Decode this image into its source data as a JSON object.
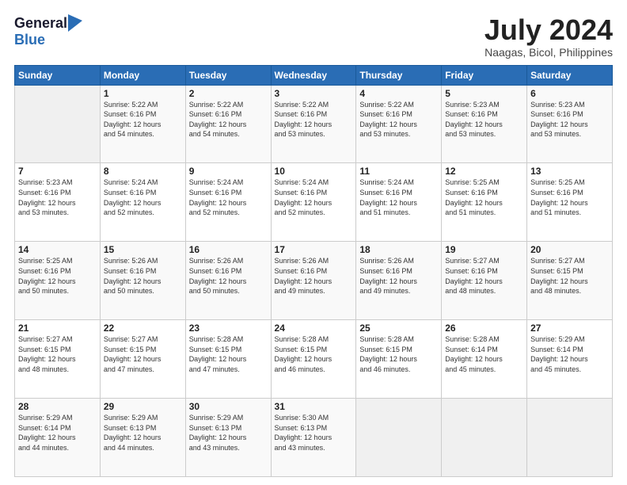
{
  "logo": {
    "general": "General",
    "blue": "Blue"
  },
  "title": "July 2024",
  "location": "Naagas, Bicol, Philippines",
  "header_days": [
    "Sunday",
    "Monday",
    "Tuesday",
    "Wednesday",
    "Thursday",
    "Friday",
    "Saturday"
  ],
  "weeks": [
    [
      {
        "day": "",
        "info": ""
      },
      {
        "day": "1",
        "info": "Sunrise: 5:22 AM\nSunset: 6:16 PM\nDaylight: 12 hours\nand 54 minutes."
      },
      {
        "day": "2",
        "info": "Sunrise: 5:22 AM\nSunset: 6:16 PM\nDaylight: 12 hours\nand 54 minutes."
      },
      {
        "day": "3",
        "info": "Sunrise: 5:22 AM\nSunset: 6:16 PM\nDaylight: 12 hours\nand 53 minutes."
      },
      {
        "day": "4",
        "info": "Sunrise: 5:22 AM\nSunset: 6:16 PM\nDaylight: 12 hours\nand 53 minutes."
      },
      {
        "day": "5",
        "info": "Sunrise: 5:23 AM\nSunset: 6:16 PM\nDaylight: 12 hours\nand 53 minutes."
      },
      {
        "day": "6",
        "info": "Sunrise: 5:23 AM\nSunset: 6:16 PM\nDaylight: 12 hours\nand 53 minutes."
      }
    ],
    [
      {
        "day": "7",
        "info": "Sunrise: 5:23 AM\nSunset: 6:16 PM\nDaylight: 12 hours\nand 53 minutes."
      },
      {
        "day": "8",
        "info": "Sunrise: 5:24 AM\nSunset: 6:16 PM\nDaylight: 12 hours\nand 52 minutes."
      },
      {
        "day": "9",
        "info": "Sunrise: 5:24 AM\nSunset: 6:16 PM\nDaylight: 12 hours\nand 52 minutes."
      },
      {
        "day": "10",
        "info": "Sunrise: 5:24 AM\nSunset: 6:16 PM\nDaylight: 12 hours\nand 52 minutes."
      },
      {
        "day": "11",
        "info": "Sunrise: 5:24 AM\nSunset: 6:16 PM\nDaylight: 12 hours\nand 51 minutes."
      },
      {
        "day": "12",
        "info": "Sunrise: 5:25 AM\nSunset: 6:16 PM\nDaylight: 12 hours\nand 51 minutes."
      },
      {
        "day": "13",
        "info": "Sunrise: 5:25 AM\nSunset: 6:16 PM\nDaylight: 12 hours\nand 51 minutes."
      }
    ],
    [
      {
        "day": "14",
        "info": "Sunrise: 5:25 AM\nSunset: 6:16 PM\nDaylight: 12 hours\nand 50 minutes."
      },
      {
        "day": "15",
        "info": "Sunrise: 5:26 AM\nSunset: 6:16 PM\nDaylight: 12 hours\nand 50 minutes."
      },
      {
        "day": "16",
        "info": "Sunrise: 5:26 AM\nSunset: 6:16 PM\nDaylight: 12 hours\nand 50 minutes."
      },
      {
        "day": "17",
        "info": "Sunrise: 5:26 AM\nSunset: 6:16 PM\nDaylight: 12 hours\nand 49 minutes."
      },
      {
        "day": "18",
        "info": "Sunrise: 5:26 AM\nSunset: 6:16 PM\nDaylight: 12 hours\nand 49 minutes."
      },
      {
        "day": "19",
        "info": "Sunrise: 5:27 AM\nSunset: 6:16 PM\nDaylight: 12 hours\nand 48 minutes."
      },
      {
        "day": "20",
        "info": "Sunrise: 5:27 AM\nSunset: 6:15 PM\nDaylight: 12 hours\nand 48 minutes."
      }
    ],
    [
      {
        "day": "21",
        "info": "Sunrise: 5:27 AM\nSunset: 6:15 PM\nDaylight: 12 hours\nand 48 minutes."
      },
      {
        "day": "22",
        "info": "Sunrise: 5:27 AM\nSunset: 6:15 PM\nDaylight: 12 hours\nand 47 minutes."
      },
      {
        "day": "23",
        "info": "Sunrise: 5:28 AM\nSunset: 6:15 PM\nDaylight: 12 hours\nand 47 minutes."
      },
      {
        "day": "24",
        "info": "Sunrise: 5:28 AM\nSunset: 6:15 PM\nDaylight: 12 hours\nand 46 minutes."
      },
      {
        "day": "25",
        "info": "Sunrise: 5:28 AM\nSunset: 6:15 PM\nDaylight: 12 hours\nand 46 minutes."
      },
      {
        "day": "26",
        "info": "Sunrise: 5:28 AM\nSunset: 6:14 PM\nDaylight: 12 hours\nand 45 minutes."
      },
      {
        "day": "27",
        "info": "Sunrise: 5:29 AM\nSunset: 6:14 PM\nDaylight: 12 hours\nand 45 minutes."
      }
    ],
    [
      {
        "day": "28",
        "info": "Sunrise: 5:29 AM\nSunset: 6:14 PM\nDaylight: 12 hours\nand 44 minutes."
      },
      {
        "day": "29",
        "info": "Sunrise: 5:29 AM\nSunset: 6:13 PM\nDaylight: 12 hours\nand 44 minutes."
      },
      {
        "day": "30",
        "info": "Sunrise: 5:29 AM\nSunset: 6:13 PM\nDaylight: 12 hours\nand 43 minutes."
      },
      {
        "day": "31",
        "info": "Sunrise: 5:30 AM\nSunset: 6:13 PM\nDaylight: 12 hours\nand 43 minutes."
      },
      {
        "day": "",
        "info": ""
      },
      {
        "day": "",
        "info": ""
      },
      {
        "day": "",
        "info": ""
      }
    ]
  ]
}
